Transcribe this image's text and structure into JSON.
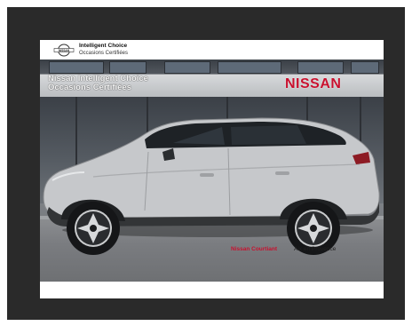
{
  "header": {
    "brand_line1": "Intelligent Choice",
    "brand_line2": "Occasions Certifiées",
    "logo_text": "NISSAN"
  },
  "photo": {
    "sign_left_line1": "Nissan Intelligent Choice",
    "sign_left_line2": "Occasions Certifiées",
    "sign_right": "NISSAN"
  },
  "footer": {
    "dealer": "Nissan Courtiant",
    "city": "Aix en Provence"
  },
  "colors": {
    "brand_red": "#c8102e",
    "frame": "#2a2a2a"
  }
}
